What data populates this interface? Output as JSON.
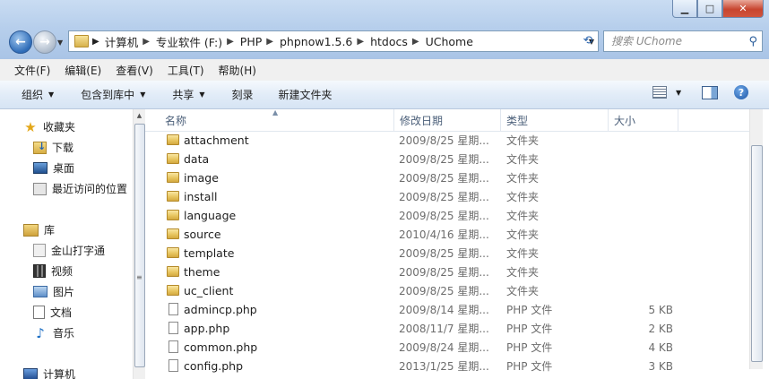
{
  "window": {
    "caption_min": "▁",
    "caption_max": "□",
    "caption_close": "✕"
  },
  "nav": {
    "back": "←",
    "forward": "→"
  },
  "address": {
    "crumbs": [
      "计算机",
      "专业软件 (F:)",
      "PHP",
      "phpnow1.5.6",
      "htdocs",
      "UChome"
    ]
  },
  "search": {
    "placeholder": "搜索 UChome"
  },
  "menu": [
    "文件(F)",
    "编辑(E)",
    "查看(V)",
    "工具(T)",
    "帮助(H)"
  ],
  "toolbar": {
    "organize": "组织",
    "include_in_library": "包含到库中",
    "share": "共享",
    "burn": "刻录",
    "new_folder": "新建文件夹",
    "help": "?"
  },
  "sidebar": {
    "favorites": {
      "label": "收藏夹",
      "items": [
        "下载",
        "桌面",
        "最近访问的位置"
      ]
    },
    "libraries": {
      "label": "库",
      "items": [
        "金山打字通",
        "视频",
        "图片",
        "文档",
        "音乐"
      ]
    },
    "computer": {
      "label": "计算机"
    }
  },
  "columns": {
    "name": "名称",
    "date": "修改日期",
    "type": "类型",
    "size": "大小"
  },
  "files": [
    {
      "name": "attachment",
      "date": "2009/8/25 星期...",
      "type": "文件夹",
      "size": "",
      "kind": "folder"
    },
    {
      "name": "data",
      "date": "2009/8/25 星期...",
      "type": "文件夹",
      "size": "",
      "kind": "folder"
    },
    {
      "name": "image",
      "date": "2009/8/25 星期...",
      "type": "文件夹",
      "size": "",
      "kind": "folder"
    },
    {
      "name": "install",
      "date": "2009/8/25 星期...",
      "type": "文件夹",
      "size": "",
      "kind": "folder"
    },
    {
      "name": "language",
      "date": "2009/8/25 星期...",
      "type": "文件夹",
      "size": "",
      "kind": "folder"
    },
    {
      "name": "source",
      "date": "2010/4/16 星期...",
      "type": "文件夹",
      "size": "",
      "kind": "folder"
    },
    {
      "name": "template",
      "date": "2009/8/25 星期...",
      "type": "文件夹",
      "size": "",
      "kind": "folder"
    },
    {
      "name": "theme",
      "date": "2009/8/25 星期...",
      "type": "文件夹",
      "size": "",
      "kind": "folder"
    },
    {
      "name": "uc_client",
      "date": "2009/8/25 星期...",
      "type": "文件夹",
      "size": "",
      "kind": "folder"
    },
    {
      "name": "admincp.php",
      "date": "2009/8/14 星期...",
      "type": "PHP 文件",
      "size": "5 KB",
      "kind": "file"
    },
    {
      "name": "app.php",
      "date": "2008/11/7 星期...",
      "type": "PHP 文件",
      "size": "2 KB",
      "kind": "file"
    },
    {
      "name": "common.php",
      "date": "2009/8/24 星期...",
      "type": "PHP 文件",
      "size": "4 KB",
      "kind": "file"
    },
    {
      "name": "config.php",
      "date": "2013/1/25 星期...",
      "type": "PHP 文件",
      "size": "3 KB",
      "kind": "file"
    }
  ]
}
